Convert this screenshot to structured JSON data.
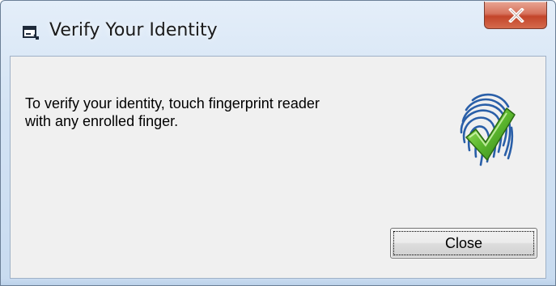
{
  "window": {
    "title": "Verify Your Identity",
    "title_icon": "app-window-icon",
    "close_icon": "close-x-icon"
  },
  "dialog": {
    "message_line1": "To verify your identity, touch fingerprint reader",
    "message_line2": "with any enrolled finger.",
    "illustration_icon": "fingerprint-checkmark-icon",
    "close_button_label": "Close"
  },
  "colors": {
    "frame": "#c8dbf0",
    "client_background": "#f0f0f0",
    "close_caption_button": "#c3452a",
    "fingerprint_blue": "#2a5fa8",
    "checkmark_green": "#5cb82e"
  }
}
